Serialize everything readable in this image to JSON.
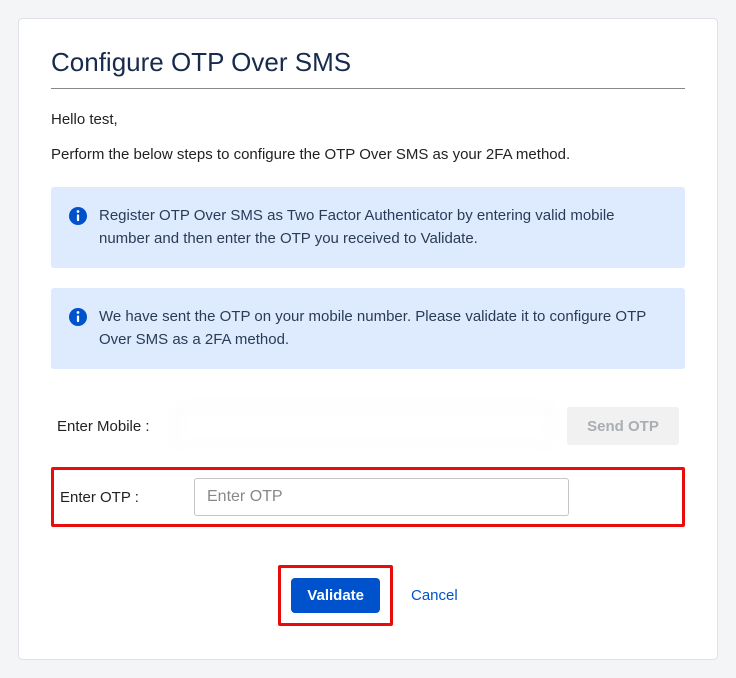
{
  "title": "Configure OTP Over SMS",
  "greeting": "Hello test,",
  "instruction": "Perform the below steps to configure the OTP Over SMS as your 2FA method.",
  "info_box_1": "Register OTP Over SMS as Two Factor Authenticator by entering valid mobile number and then enter the OTP you received to Validate.",
  "info_box_2": "We have sent the OTP on your mobile number. Please validate it to configure OTP Over SMS as a 2FA method.",
  "form": {
    "mobile_label": "Enter Mobile :",
    "mobile_value": "",
    "send_otp_label": "Send OTP",
    "otp_label": "Enter OTP :",
    "otp_placeholder": "Enter OTP",
    "otp_value": ""
  },
  "actions": {
    "validate_label": "Validate",
    "cancel_label": "Cancel"
  },
  "colors": {
    "accent": "#0052cc",
    "info_bg": "#deebff",
    "highlight_border": "#e80c0c"
  }
}
